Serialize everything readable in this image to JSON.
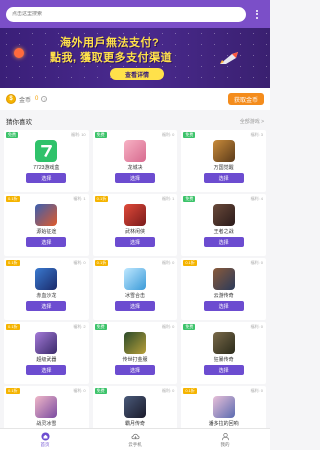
{
  "search": {
    "placeholder": "点击这里搜索"
  },
  "banner": {
    "line1": "海外用戶無法支付?",
    "line2": "點我, 獲取更多支付渠道",
    "button": "查看详情"
  },
  "coins": {
    "icon": "$",
    "label": "金币",
    "value": "0",
    "help": "?",
    "get_button": "获取金币"
  },
  "section": {
    "title": "猜你喜欢",
    "more": "全部游戏 >"
  },
  "games": [
    {
      "tag": "免费",
      "tag_color": "green",
      "downloads": "福利: 10",
      "name": "7723游戏盒",
      "button": "选择",
      "thumb": "green-7"
    },
    {
      "tag": "免费",
      "tag_color": "green",
      "downloads": "福利: 0",
      "name": "龙城决",
      "button": "选择",
      "thumb": "pink"
    },
    {
      "tag": "免费",
      "tag_color": "green",
      "downloads": "福利: 3",
      "name": "万国觉醒",
      "button": "选择",
      "thumb": "warrior"
    },
    {
      "tag": "0.1折",
      "tag_color": "yellow",
      "downloads": "福利: 1",
      "name": "源始征途",
      "button": "选择",
      "thumb": "fire"
    },
    {
      "tag": "0.1折",
      "tag_color": "yellow",
      "downloads": "福利: 1",
      "name": "武林闲侠",
      "button": "选择",
      "thumb": "red"
    },
    {
      "tag": "免费",
      "tag_color": "green",
      "downloads": "福利: 4",
      "name": "王者之战",
      "button": "选择",
      "thumb": "dark"
    },
    {
      "tag": "0.1折",
      "tag_color": "yellow",
      "downloads": "福利: 0",
      "name": "赤血沙龙",
      "button": "选择",
      "thumb": "blue"
    },
    {
      "tag": "0.1折",
      "tag_color": "yellow",
      "downloads": "福利: 0",
      "name": "冰雪合击",
      "button": "选择",
      "thumb": "ice"
    },
    {
      "tag": "0.1折",
      "tag_color": "yellow",
      "downloads": "福利: 0",
      "name": "云游传奇",
      "button": "选择",
      "thumb": "cloud"
    },
    {
      "tag": "0.1折",
      "tag_color": "yellow",
      "downloads": "福利: 2",
      "name": "超级武器",
      "button": "选择",
      "thumb": "purple"
    },
    {
      "tag": "免费",
      "tag_color": "green",
      "downloads": "福利: 0",
      "name": "传世打金服",
      "button": "选择",
      "thumb": "gold"
    },
    {
      "tag": "免费",
      "tag_color": "green",
      "downloads": "福利: 0",
      "name": "狂暴传奇",
      "button": "选择",
      "thumb": "monster"
    },
    {
      "tag": "0.1折",
      "tag_color": "yellow",
      "downloads": "福利: 0",
      "name": "战灵冰雪",
      "button": "选择",
      "thumb": "girl"
    },
    {
      "tag": "免费",
      "tag_color": "green",
      "downloads": "福利: 0",
      "name": "霸月传奇",
      "button": "选择",
      "thumb": "armor"
    },
    {
      "tag": "0.1折",
      "tag_color": "yellow",
      "downloads": "福利: 0",
      "name": "潘多拉的回响",
      "button": "选择",
      "thumb": "anime"
    }
  ],
  "nav": [
    {
      "label": "首页",
      "icon": "home-icon",
      "active": true
    },
    {
      "label": "云手机",
      "icon": "cloud-phone-icon",
      "active": false
    },
    {
      "label": "我的",
      "icon": "user-icon",
      "active": false
    }
  ],
  "colors": {
    "primary": "#6c4cd0",
    "topbar": "#7b4fc8",
    "coin": "#f5b400",
    "get_coin": "#f48c1c",
    "tag_free": "#3cc36a",
    "tag_discount": "#f5b400"
  }
}
